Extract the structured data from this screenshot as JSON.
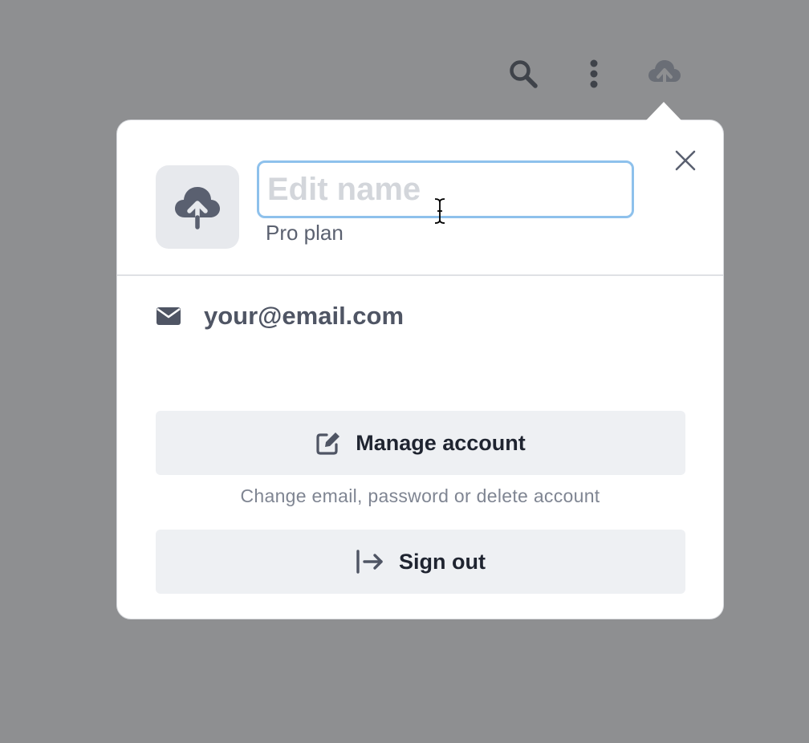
{
  "toolbar": {
    "icons": [
      "search-icon",
      "more-vertical-icon",
      "cloud-upload-icon"
    ]
  },
  "profile": {
    "avatar_icon": "cloud-upload-icon",
    "name_value": "",
    "name_placeholder": "Edit name",
    "plan": "Pro plan"
  },
  "account": {
    "email_icon": "envelope-icon",
    "email": "your@email.com"
  },
  "actions": {
    "manage_label": "Manage account",
    "manage_icon": "edit-icon",
    "manage_hint": "Change email, password or delete account",
    "signout_label": "Sign out",
    "signout_icon": "sign-out-icon"
  },
  "colors": {
    "overlay": "#8e8f91",
    "focus_ring": "#8ec1ec",
    "button_bg": "#eef0f3",
    "icon": "#5a6070"
  }
}
